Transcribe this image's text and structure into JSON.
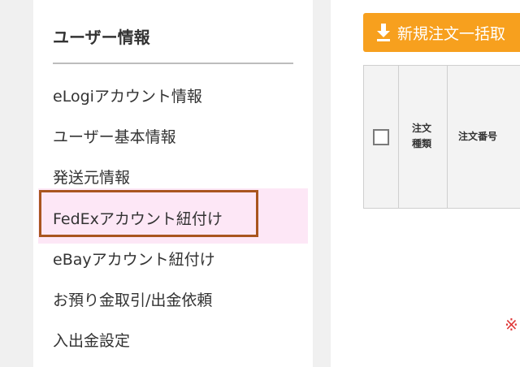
{
  "sidebar": {
    "title": "ユーザー情報",
    "items": [
      {
        "label": "eLogiアカウント情報"
      },
      {
        "label": "ユーザー基本情報"
      },
      {
        "label": "発送元情報"
      },
      {
        "label": "FedExアカウント紐付け"
      },
      {
        "label": "eBayアカウント紐付け"
      },
      {
        "label": "お預り金取引/出金依頼"
      },
      {
        "label": "入出金設定"
      }
    ],
    "highlight_color": "#a9551f",
    "active_bg_color": "#fde7f6"
  },
  "main": {
    "download_button_label": "新規注文一括取",
    "accent_color": "#f7a01e",
    "table": {
      "columns": [
        "注文種類",
        "注文番号"
      ],
      "column_type_line1": "注文",
      "column_type_line2": "種類"
    },
    "notice_mark": "※"
  }
}
